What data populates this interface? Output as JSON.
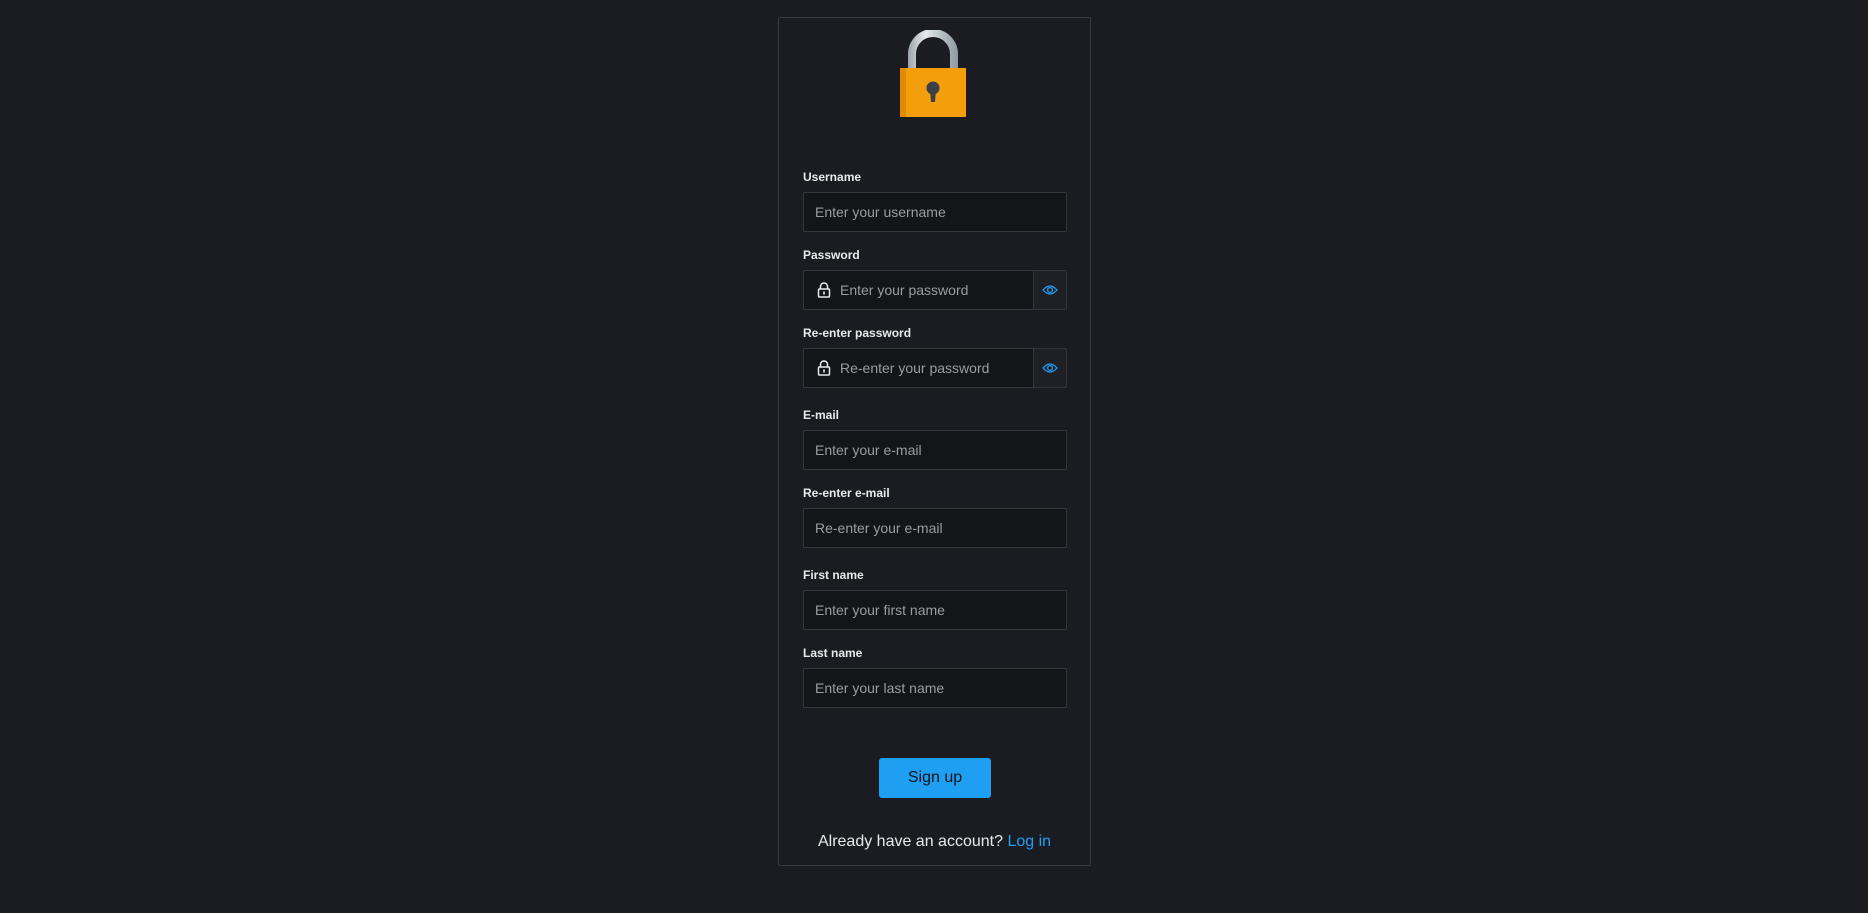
{
  "form": {
    "fields": {
      "username": {
        "label": "Username",
        "placeholder": "Enter your username"
      },
      "password": {
        "label": "Password",
        "placeholder": "Enter your password"
      },
      "password_confirm": {
        "label": "Re-enter password",
        "placeholder": "Re-enter your password"
      },
      "email": {
        "label": "E-mail",
        "placeholder": "Enter your e-mail"
      },
      "email_confirm": {
        "label": "Re-enter e-mail",
        "placeholder": "Re-enter your e-mail"
      },
      "first_name": {
        "label": "First name",
        "placeholder": "Enter your first name"
      },
      "last_name": {
        "label": "Last name",
        "placeholder": "Enter your last name"
      }
    },
    "submit_label": "Sign up"
  },
  "footer": {
    "prompt": "Already have an account?",
    "link_label": "Log in"
  },
  "icons": {
    "logo": "padlock-icon",
    "password_prefix": "lock-icon",
    "password_toggle": "eye-icon"
  },
  "colors": {
    "background": "#1b1c21",
    "accent": "#1e9ff2",
    "padlock_body": "#f39c12"
  }
}
